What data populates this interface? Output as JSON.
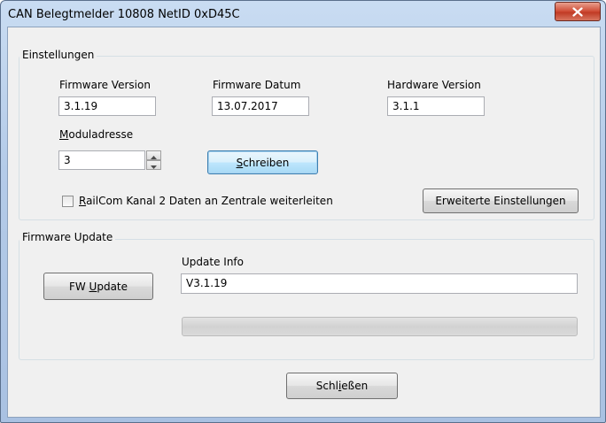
{
  "window": {
    "title": "CAN  Belegtmelder 10808 NetID 0xD45C"
  },
  "settings": {
    "group_label": "Einstellungen",
    "firmware_version": {
      "label": "Firmware Version",
      "value": "3.1.19"
    },
    "firmware_date": {
      "label": "Firmware Datum",
      "value": "13.07.2017"
    },
    "hardware_version": {
      "label": "Hardware Version",
      "value": "3.1.1"
    },
    "module_address": {
      "label_mnemonic": "M",
      "label_rest": "oduladresse",
      "value": "3"
    },
    "write_button": {
      "mnemonic": "S",
      "rest": "chreiben"
    },
    "railcom_checkbox": {
      "mnemonic": "R",
      "rest": "ailCom Kanal 2 Daten an Zentrale weiterleiten",
      "checked": false
    },
    "advanced_button": "Erweiterte Einstellungen"
  },
  "firmware_update": {
    "group_label": "Firmware Update",
    "fw_button": {
      "prefix": "FW ",
      "mnemonic": "U",
      "rest": "pdate"
    },
    "update_info": {
      "label": "Update Info",
      "value": "V3.1.19"
    },
    "progress": 0
  },
  "close_button": {
    "prefix": "Schl",
    "mnemonic": "i",
    "rest": "eßen"
  },
  "icons": {
    "close": "close-icon",
    "spin_up": "arrow-up-icon",
    "spin_down": "arrow-down-icon"
  }
}
